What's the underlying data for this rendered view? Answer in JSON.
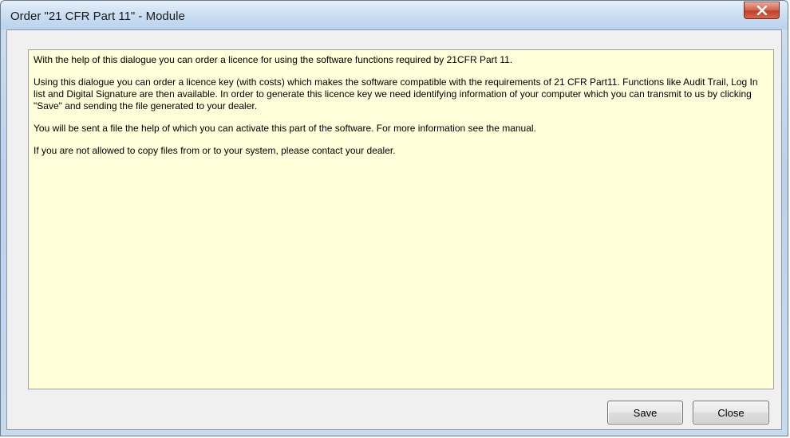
{
  "window": {
    "title": "Order \"21 CFR Part 11\" - Module"
  },
  "message": {
    "paragraphs": [
      "With the help of this dialogue you can order a licence for using the software functions required by  21CFR Part 11.",
      "Using this dialogue you can order a licence key (with costs) which makes the software compatible with the requirements of 21 CFR Part11. Functions like Audit Trail, Log In list and Digital Signature are then available. In order to generate this licence key we need identifying information of your computer which you can transmit to us by clicking \"Save\" and sending the file generated to your dealer.",
      "You will be sent a file the help of which you can activate this part of the software. For more information see the manual.",
      "If you are not allowed to copy files from or to your system, please contact your dealer."
    ]
  },
  "buttons": {
    "save_label": "Save",
    "close_label": "Close"
  },
  "icons": {
    "close": "close-x-icon"
  },
  "colors": {
    "message_background": "#ffffd9",
    "close_button": "#c7432b"
  }
}
